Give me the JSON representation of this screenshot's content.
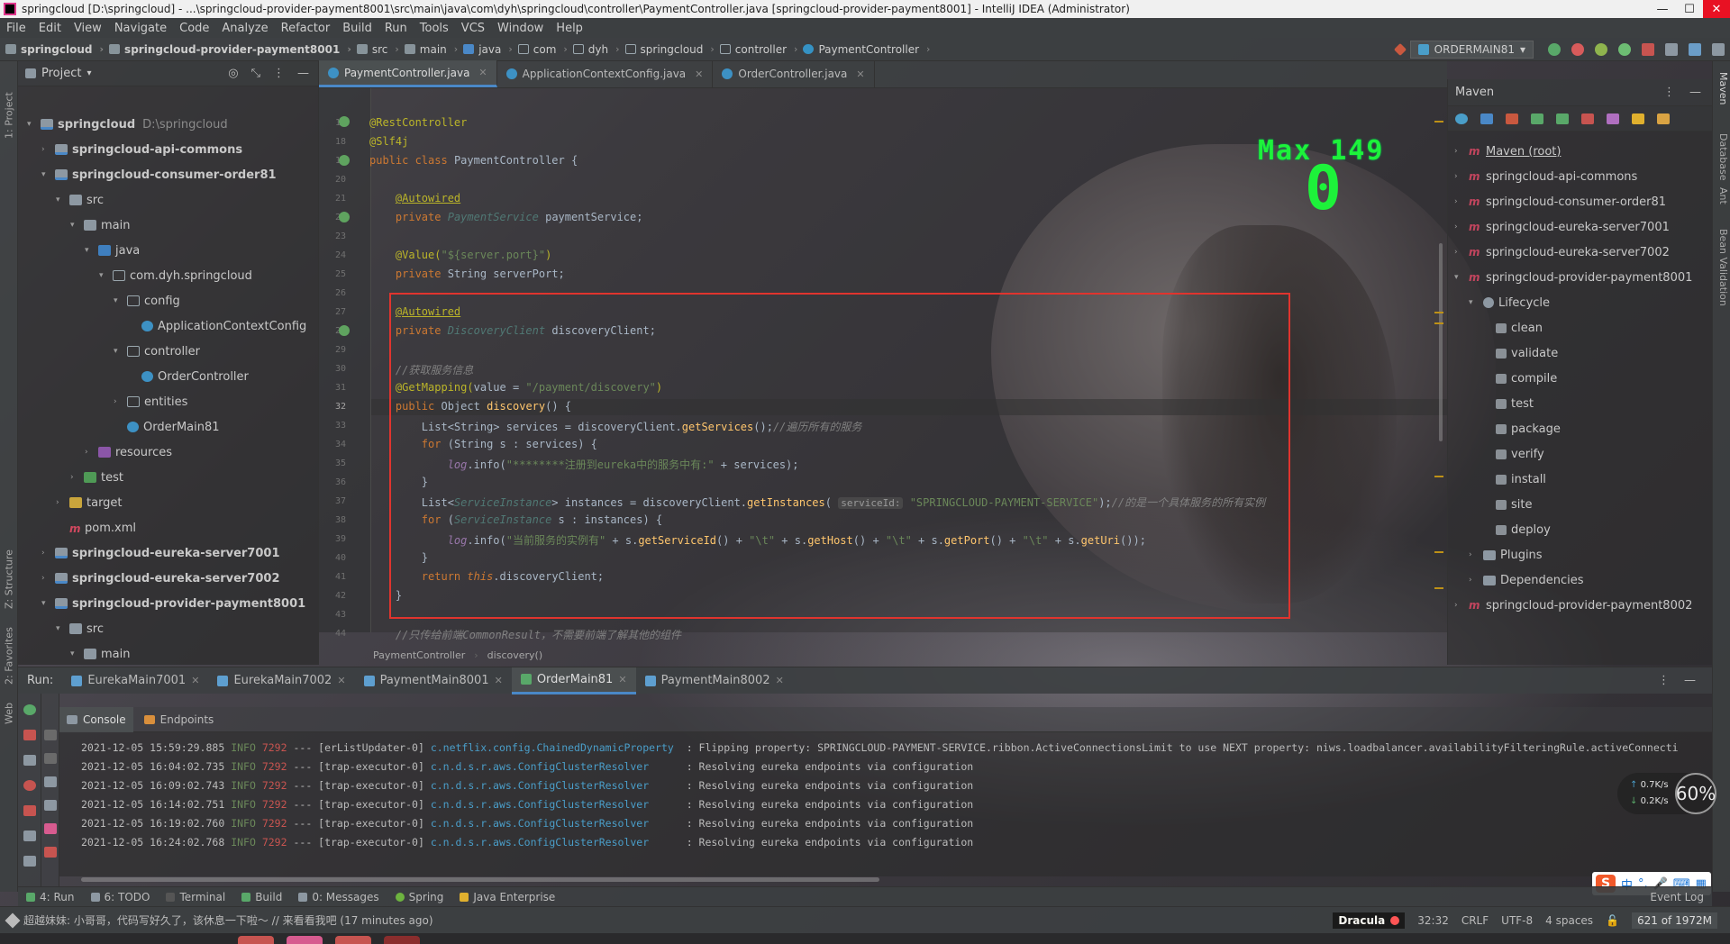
{
  "window": {
    "title": "springcloud [D:\\springcloud] - ...\\springcloud-provider-payment8001\\src\\main\\java\\com\\dyh\\springcloud\\controller\\PaymentController.java [springcloud-provider-payment8001] - IntelliJ IDEA (Administrator)",
    "minimize": "—",
    "maximize": "☐",
    "close": "✕"
  },
  "menu": [
    "File",
    "Edit",
    "View",
    "Navigate",
    "Code",
    "Analyze",
    "Refactor",
    "Build",
    "Run",
    "Tools",
    "VCS",
    "Window",
    "Help"
  ],
  "nav": {
    "crumbs": [
      "springcloud",
      "springcloud-provider-payment8001",
      "src",
      "main",
      "java",
      "com",
      "dyh",
      "springcloud",
      "controller",
      "PaymentController"
    ],
    "run_config": "ORDERMAIN81"
  },
  "left_strip": {
    "project": "1: Project",
    "structure": "Z: Structure",
    "favorites": "2: Favorites",
    "web": "Web"
  },
  "right_strip": {
    "maven": "Maven",
    "database": "Database",
    "ant": "Ant",
    "bean": "Bean Validation"
  },
  "project": {
    "title": "Project",
    "tree": [
      {
        "label": "springcloud",
        "extra": "D:\\springcloud",
        "bold": true
      },
      {
        "label": "springcloud-api-commons",
        "bold": true
      },
      {
        "label": "springcloud-consumer-order81",
        "bold": true
      },
      {
        "label": "src"
      },
      {
        "label": "main"
      },
      {
        "label": "java"
      },
      {
        "label": "com.dyh.springcloud"
      },
      {
        "label": "config"
      },
      {
        "label": "ApplicationContextConfig"
      },
      {
        "label": "controller"
      },
      {
        "label": "OrderController"
      },
      {
        "label": "entities"
      },
      {
        "label": "OrderMain81"
      },
      {
        "label": "resources"
      },
      {
        "label": "test"
      },
      {
        "label": "target"
      },
      {
        "label": "pom.xml"
      },
      {
        "label": "springcloud-eureka-server7001",
        "bold": true
      },
      {
        "label": "springcloud-eureka-server7002",
        "bold": true
      },
      {
        "label": "springcloud-provider-payment8001",
        "bold": true
      },
      {
        "label": "src"
      },
      {
        "label": "main"
      }
    ]
  },
  "editor": {
    "tabs": [
      "PaymentController.java",
      "ApplicationContextConfig.java",
      "OrderController.java"
    ],
    "line_numbers": [
      "17",
      "18",
      "19",
      "20",
      "21",
      "22",
      "23",
      "24",
      "25",
      "26",
      "27",
      "28",
      "29",
      "30",
      "31",
      "32",
      "33",
      "34",
      "35",
      "36",
      "37",
      "38",
      "39",
      "40",
      "41",
      "42",
      "43",
      "44"
    ],
    "code": {
      "l17": "@RestController",
      "l18": "@Slf4j",
      "l19_a": "public class",
      "l19_b": "PaymentController {",
      "l21": "@Autowired",
      "l22_a": "private",
      "l22_b": "PaymentService",
      "l22_c": "paymentService;",
      "l24_a": "@Value(",
      "l24_b": "\"${server.port}\"",
      "l24_c": ")",
      "l25_a": "private",
      "l25_b": "String serverPort;",
      "l27": "@Autowired",
      "l28_a": "private",
      "l28_b": "DiscoveryClient",
      "l28_c": "discoveryClient;",
      "l30": "//获取服务信息",
      "l31_a": "@GetMapping(",
      "l31_b": "value = ",
      "l31_c": "\"/payment/discovery\"",
      "l31_d": ")",
      "l32_a": "public",
      "l32_b": "Object",
      "l32_c": "discovery",
      "l32_d": "() {",
      "l33_a": "List<String> services = discoveryClient.",
      "l33_b": "getServices",
      "l33_c": "();",
      "l33_d": "//遍历所有的服务",
      "l34_a": "for",
      "l34_b": "(String s : services) {",
      "l35_a": "log",
      "l35_b": ".info(",
      "l35_c": "\"********注册到eureka中的服务中有:\"",
      "l35_d": " + services);",
      "l36": "}",
      "l37_a": "List<",
      "l37_b": "ServiceInstance",
      "l37_c": "> instances = discoveryClient.",
      "l37_d": "getInstances",
      "l37_e": "(",
      "l37_hint": "serviceId:",
      "l37_f": "\"SPRINGCLOUD-PAYMENT-SERVICE\"",
      "l37_g": ");",
      "l37_h": "//的是一个具体服务的所有实例",
      "l38_a": "for",
      "l38_b": "(",
      "l38_c": "ServiceInstance",
      "l38_d": " s : instances) {",
      "l39_a": "log",
      "l39_b": ".info(",
      "l39_c": "\"当前服务的实例有\"",
      "l39_d": " + s.",
      "l39_e": "getServiceId",
      "l39_f": "() + ",
      "l39_g": "\"\\t\"",
      "l39_h": " + s.",
      "l39_i": "getHost",
      "l39_j": "() + ",
      "l39_k": "\"\\t\"",
      "l39_l": " + s.",
      "l39_m": "getPort",
      "l39_n": "() + ",
      "l39_o": "\"\\t\"",
      "l39_p": " + s.",
      "l39_q": "getUri",
      "l39_r": "());",
      "l40": "}",
      "l41_a": "return",
      "l41_b": "this",
      "l41_c": ".discoveryClient;",
      "l42": "}",
      "l44": "//只传给前端CommonResult，不需要前端了解其他的组件"
    },
    "breadcrumb": [
      "PaymentController",
      "discovery()"
    ],
    "overlay": {
      "max_label": "Max  149",
      "counter": "0"
    }
  },
  "maven": {
    "title": "Maven",
    "tree": [
      {
        "label": "Maven (root)"
      },
      {
        "label": "springcloud-api-commons"
      },
      {
        "label": "springcloud-consumer-order81"
      },
      {
        "label": "springcloud-eureka-server7001"
      },
      {
        "label": "springcloud-eureka-server7002"
      },
      {
        "label": "springcloud-provider-payment8001"
      },
      {
        "label": "Lifecycle"
      },
      {
        "label": "clean"
      },
      {
        "label": "validate"
      },
      {
        "label": "compile"
      },
      {
        "label": "test"
      },
      {
        "label": "package"
      },
      {
        "label": "verify"
      },
      {
        "label": "install"
      },
      {
        "label": "site"
      },
      {
        "label": "deploy"
      },
      {
        "label": "Plugins"
      },
      {
        "label": "Dependencies"
      },
      {
        "label": "springcloud-provider-payment8002"
      }
    ]
  },
  "run": {
    "label": "Run:",
    "tabs": [
      "EurekaMain7001",
      "EurekaMain7002",
      "PaymentMain8001",
      "OrderMain81",
      "PaymentMain8002"
    ],
    "subtabs": [
      "Console",
      "Endpoints"
    ],
    "logs": [
      {
        "ts": "2021-12-05 15:59:29.885",
        "lvl": "INFO",
        "pid": "7292",
        "thread": "--- [erListUpdater-0]",
        "cls": "c.netflix.config.ChainedDynamicProperty",
        "msg": "  : Flipping property: SPRINGCLOUD-PAYMENT-SERVICE.ribbon.ActiveConnectionsLimit to use NEXT property: niws.loadbalancer.availabilityFilteringRule.activeConnecti"
      },
      {
        "ts": "2021-12-05 16:04:02.735",
        "lvl": "INFO",
        "pid": "7292",
        "thread": "--- [trap-executor-0]",
        "cls": "c.n.d.s.r.aws.ConfigClusterResolver    ",
        "msg": "  : Resolving eureka endpoints via configuration"
      },
      {
        "ts": "2021-12-05 16:09:02.743",
        "lvl": "INFO",
        "pid": "7292",
        "thread": "--- [trap-executor-0]",
        "cls": "c.n.d.s.r.aws.ConfigClusterResolver    ",
        "msg": "  : Resolving eureka endpoints via configuration"
      },
      {
        "ts": "2021-12-05 16:14:02.751",
        "lvl": "INFO",
        "pid": "7292",
        "thread": "--- [trap-executor-0]",
        "cls": "c.n.d.s.r.aws.ConfigClusterResolver    ",
        "msg": "  : Resolving eureka endpoints via configuration"
      },
      {
        "ts": "2021-12-05 16:19:02.760",
        "lvl": "INFO",
        "pid": "7292",
        "thread": "--- [trap-executor-0]",
        "cls": "c.n.d.s.r.aws.ConfigClusterResolver    ",
        "msg": "  : Resolving eureka endpoints via configuration"
      },
      {
        "ts": "2021-12-05 16:24:02.768",
        "lvl": "INFO",
        "pid": "7292",
        "thread": "--- [trap-executor-0]",
        "cls": "c.n.d.s.r.aws.ConfigClusterResolver    ",
        "msg": "  : Resolving eureka endpoints via configuration"
      }
    ]
  },
  "net_widget": {
    "up": "0.7K/s",
    "down": "0.2K/s",
    "percent": "60%"
  },
  "ime": {
    "logo": "S",
    "lang": "中",
    "punct": "°,",
    "mic": "🎤",
    "keyboard": "⌨",
    "more": "▦"
  },
  "tool_windows": [
    "4: Run",
    "6: TODO",
    "Terminal",
    "Build",
    "0: Messages",
    "Spring",
    "Java Enterprise"
  ],
  "event_log": "Event Log",
  "status": {
    "message": "超越妹妹: 小哥哥，代码写好久了，该休息一下啦～ // 来看看我吧 (17 minutes ago)",
    "theme": "Dracula",
    "position": "32:32",
    "line_sep": "CRLF",
    "encoding": "UTF-8",
    "indent": "4 spaces",
    "memory": "621 of 1972M"
  },
  "colors": {
    "accent": "#4a88c7",
    "highlight_box": "#e0342e",
    "overlay_green": "#1df23a",
    "keyword": "#cc7832",
    "annotation": "#bbb529",
    "string": "#6a8759",
    "method": "#ffc66d"
  }
}
